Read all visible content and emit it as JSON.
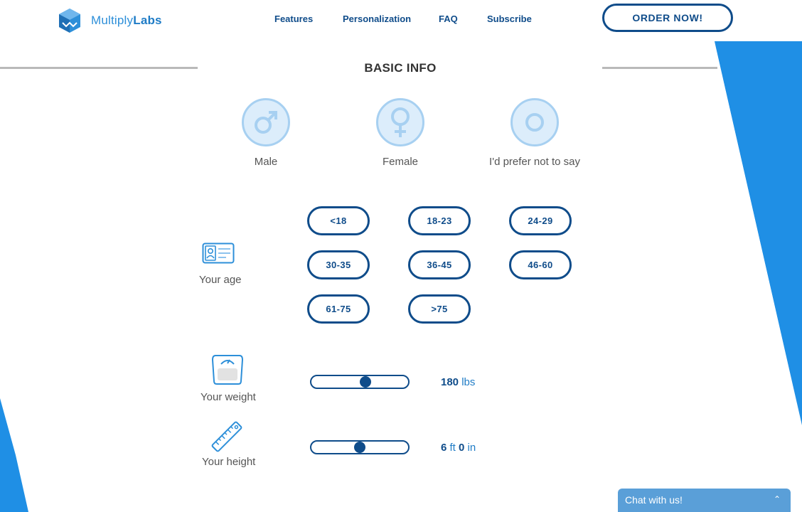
{
  "brand": {
    "name_light": "Multiply",
    "name_bold": "Labs"
  },
  "nav": {
    "items": [
      {
        "label": "Features"
      },
      {
        "label": "Personalization"
      },
      {
        "label": "FAQ"
      },
      {
        "label": "Subscribe"
      }
    ],
    "order_label": "ORDER NOW!"
  },
  "section": {
    "title": "BASIC INFO"
  },
  "gender": {
    "options": [
      {
        "label": "Male",
        "icon": "male-icon"
      },
      {
        "label": "Female",
        "icon": "female-icon"
      },
      {
        "label": "I'd prefer not to say",
        "icon": "neutral-icon"
      }
    ]
  },
  "age": {
    "label": "Your age",
    "icon": "id-card-icon",
    "options": [
      "<18",
      "18-23",
      "24-29",
      "30-35",
      "36-45",
      "46-60",
      "61-75",
      ">75"
    ]
  },
  "weight": {
    "label": "Your weight",
    "icon": "scale-icon",
    "value": "180",
    "unit": "lbs",
    "slider_fraction": 0.57
  },
  "height": {
    "label": "Your height",
    "icon": "ruler-icon",
    "feet": "6",
    "feet_unit": "ft",
    "inches": "0",
    "inches_unit": "in",
    "slider_fraction": 0.5
  },
  "chat": {
    "label": "Chat with us!"
  },
  "colors": {
    "primary": "#0f4c8a",
    "accent": "#1f8fe5",
    "light": "#dcedfb"
  }
}
